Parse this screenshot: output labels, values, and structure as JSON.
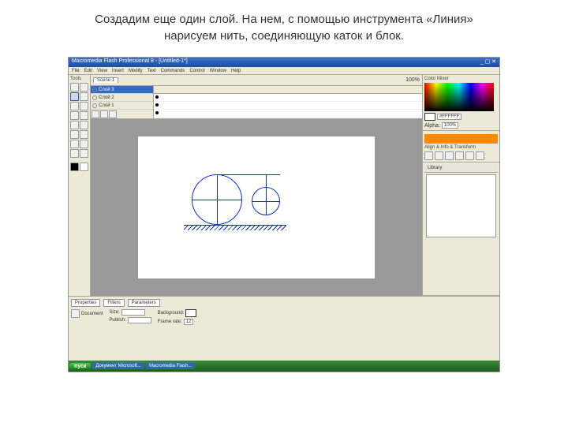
{
  "caption_line1": "Создадим еще один слой. На нем, с помощью инструмента «Линия»",
  "caption_line2": "нарисуем нить, соединяющую каток и блок.",
  "titlebar": {
    "title": "Macromedia Flash Professional 8 - [Untitled-1*]"
  },
  "menu": {
    "file": "File",
    "edit": "Edit",
    "view": "View",
    "insert": "Insert",
    "modify": "Modify",
    "text": "Text",
    "commands": "Commands",
    "control": "Control",
    "window": "Window",
    "help": "Help"
  },
  "toolbox": {
    "title": "Tools"
  },
  "timeline": {
    "tab": "Scene 1",
    "zoom": "100%",
    "layers": [
      {
        "name": "Слой 3"
      },
      {
        "name": "Слой 2"
      },
      {
        "name": "Слой 1"
      }
    ]
  },
  "panels": {
    "color_title": "Color Mixer",
    "hex": "#FFFFFF",
    "alpha_label": "Alpha:",
    "alpha_value": "100%",
    "align_title": "Align & Info & Transform",
    "library_title": "Library"
  },
  "properties": {
    "tab1": "Properties",
    "tab2": "Filters",
    "tab3": "Parameters",
    "doc_label": "Document",
    "size_label": "Size:",
    "bg_label": "Background:",
    "fps_label": "Frame rate:",
    "fps_value": "12",
    "publish_label": "Publish:"
  },
  "taskbar": {
    "start": "пуск",
    "task1": "Документ Microsoft...",
    "task2": "Macromedia Flash..."
  }
}
